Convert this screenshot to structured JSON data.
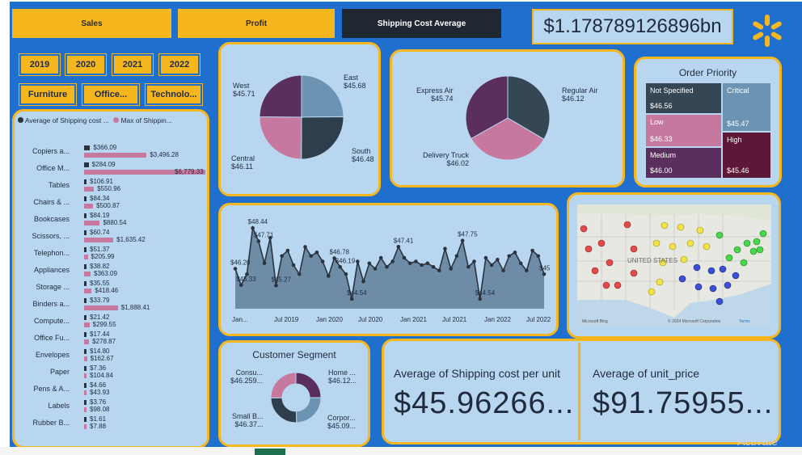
{
  "nav": {
    "sales": "Sales",
    "profit": "Profit",
    "shipping": "Shipping Cost Average"
  },
  "total_value": "$1.178789126896bn",
  "years": [
    "2019",
    "2020",
    "2021",
    "2022"
  ],
  "categories": [
    "Furniture",
    "Office...",
    "Technolo..."
  ],
  "colors": {
    "accent": "#f6b71e",
    "background": "#1f6fcf",
    "panel": "#b8d6f0",
    "dark": "#2a3440",
    "pink": "#c7789f",
    "purple": "#5a2f5e",
    "steel": "#6c93b2"
  },
  "bar_chart": {
    "legend_a": "Average of Shipping cost ...",
    "legend_b": "Max of Shippin...",
    "rows": [
      {
        "cat": "Copiers a...",
        "avg": "$366.09",
        "max": "$3,496.28"
      },
      {
        "cat": "Office M...",
        "avg": "$284.09",
        "max": "$6,779.33"
      },
      {
        "cat": "Tables",
        "avg": "$106.91",
        "max": "$550.96"
      },
      {
        "cat": "Chairs & ...",
        "avg": "$84.34",
        "max": "$500.87"
      },
      {
        "cat": "Bookcases",
        "avg": "$84.19",
        "max": "$880.54"
      },
      {
        "cat": "Scissors, ...",
        "avg": "$60.74",
        "max": "$1,635.42"
      },
      {
        "cat": "Telephon...",
        "avg": "$51.37",
        "max": "$205.99"
      },
      {
        "cat": "Appliances",
        "avg": "$38.82",
        "max": "$363.09"
      },
      {
        "cat": "Storage ...",
        "avg": "$35.55",
        "max": "$418.46"
      },
      {
        "cat": "Binders a...",
        "avg": "$33.79",
        "max": "$1,888.41"
      },
      {
        "cat": "Compute...",
        "avg": "$21.42",
        "max": "$299.55"
      },
      {
        "cat": "Office Fu...",
        "avg": "$17.44",
        "max": "$278.87"
      },
      {
        "cat": "Envelopes",
        "avg": "$14.80",
        "max": "$162.67"
      },
      {
        "cat": "Paper",
        "avg": "$7.36",
        "max": "$104.84"
      },
      {
        "cat": "Pens & A...",
        "avg": "$4.66",
        "max": "$43.93"
      },
      {
        "cat": "Labels",
        "avg": "$3.76",
        "max": "$98.08"
      },
      {
        "cat": "Rubber B...",
        "avg": "$1.61",
        "max": "$7.88"
      }
    ]
  },
  "chart_data": [
    {
      "type": "pie",
      "categories": [
        "East",
        "South",
        "Central",
        "West"
      ],
      "values": [
        45.68,
        46.48,
        46.11,
        45.71
      ],
      "labels": [
        "$45.68",
        "$46.48",
        "$46.11",
        "$45.71"
      ]
    },
    {
      "type": "pie",
      "categories": [
        "Regular Air",
        "Delivery Truck",
        "Express Air"
      ],
      "values": [
        46.12,
        46.02,
        45.74
      ],
      "labels": [
        "$46.12",
        "$46.02",
        "$45.74"
      ]
    },
    {
      "type": "area",
      "x_ticks": [
        "Jan...",
        "Jul 2019",
        "Jan 2020",
        "Jul 2020",
        "Jan 2021",
        "Jul 2021",
        "Jan 2022",
        "Jul 2022"
      ],
      "values": [
        46.2,
        45.3,
        45.9,
        48.44,
        47.71,
        46.5,
        47.9,
        45.27,
        46.9,
        47.2,
        46.4,
        45.9,
        47.4,
        46.9,
        47.1,
        46.6,
        45.8,
        46.78,
        46.3,
        45.9,
        44.54,
        46.6,
        45.5,
        46.5,
        46.2,
        46.8,
        46.3,
        46.6,
        47.41,
        46.8,
        46.5,
        46.6,
        46.4,
        46.5,
        46.3,
        46.1,
        47.3,
        46.2,
        46.9,
        47.75,
        46.3,
        46.6,
        44.54,
        46.8,
        46.4,
        46.7,
        46.1,
        46.9,
        47.1,
        46.5,
        46.1,
        47.2,
        46.9,
        45.9
      ],
      "data_labels": [
        "$46.20",
        "$48.44",
        "$47.71",
        "$45.27",
        "$46.78",
        "$44.54",
        "$47.41",
        "$47.75",
        "$44.54",
        "$45.90",
        "$45.33",
        "$46.19"
      ]
    },
    {
      "type": "pie",
      "categories": [
        "Home ...",
        "Corpor...",
        "Small B...",
        "Consu..."
      ],
      "values": [
        46.12,
        45.09,
        46.37,
        46.259
      ],
      "labels": [
        "$46.12...",
        "$45.09...",
        "$46.37...",
        "$46.259..."
      ]
    }
  ],
  "order_priority": {
    "title": "Order Priority",
    "tiles": [
      {
        "name": "Not Specified",
        "value": "$46.56"
      },
      {
        "name": "Critical",
        "value": "$45.47"
      },
      {
        "name": "Low",
        "value": "$46.33"
      },
      {
        "name": "High",
        "value": "$45.46"
      },
      {
        "name": "Medium",
        "value": "$46.00"
      }
    ]
  },
  "map": {
    "country_label": "UNITED STATES",
    "gulf_label": "Gulf of\nMexico",
    "attribution_left": "Microsoft Bing",
    "attribution_right": "© 2024 Microsoft Corporation",
    "terms": "Terms"
  },
  "customer_segment": {
    "title": "Customer Segment"
  },
  "kpi": {
    "shipping_label": "Average of Shipping cost per unit",
    "shipping_value": "$45.96266...",
    "price_label": "Average of unit_price",
    "price_value": "$91.75955..."
  },
  "watermark": "Activate"
}
